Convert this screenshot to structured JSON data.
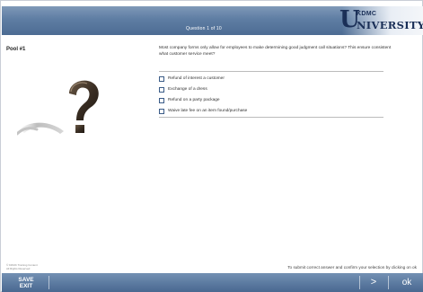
{
  "header": {
    "question_counter": "Question 1 of 10"
  },
  "logo": {
    "top": "KDMC",
    "bottom": "NIVERSITY",
    "mark": "U"
  },
  "pool": {
    "label": "Pool #1"
  },
  "question": {
    "prompt": "Most company forms only allow for employees to make determining good judgment call situations? This ensure consistent what customer service meet?",
    "options": [
      {
        "label": "Refund of interest a customer",
        "checked": false
      },
      {
        "label": "Exchange of a dress",
        "checked": false
      },
      {
        "label": "Refund on a party package",
        "checked": false
      },
      {
        "label": "Waive late fee on an item found/purchase",
        "checked": false
      }
    ]
  },
  "footer": {
    "copyright_line1": "© KDMC Training Content",
    "copyright_line2": "All Rights Reserved",
    "instruction": "To submit correct answer and confirm your selection by clicking on ok",
    "save_line1": "SAVE",
    "save_line2": "EXIT",
    "next_label": ">",
    "ok_label": "ok"
  },
  "colors": {
    "header_bar": "#5e7da3",
    "footer_bar": "#5b7aa0",
    "logo": "#1a2f57",
    "checkbox_border": "#3a5b87"
  },
  "icons": {
    "question_mark_art": "question-mark-illustration"
  }
}
